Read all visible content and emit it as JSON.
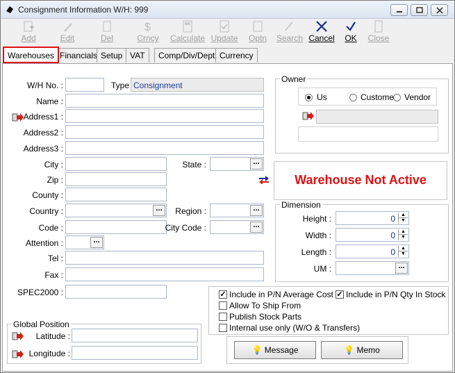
{
  "window": {
    "title": "Consignment Information   W/H: 999"
  },
  "toolbar": {
    "add": "Add",
    "edit": "Edit",
    "del": "Del",
    "crncy": "Crncy",
    "calculate": "Calculate",
    "update": "Update",
    "optn": "Optn",
    "search": "Search",
    "cancel": "Cancel",
    "ok": "OK",
    "close": "Close"
  },
  "tabs": [
    "Warehouses",
    "Financials",
    "Setup",
    "VAT",
    "Comp/Div/Dept",
    "Currency"
  ],
  "form": {
    "wh_no_label": "W/H No. :",
    "type_label": "Type",
    "type_value": "Consignment",
    "name_label": "Name :",
    "address1_label": "Address1 :",
    "address2_label": "Address2 :",
    "address3_label": "Address3 :",
    "city_label": "City :",
    "state_label": "State :",
    "zip_label": "Zip :",
    "county_label": "County :",
    "country_label": "Country :",
    "region_label": "Region :",
    "code_label": "Code :",
    "city_code_label": "City Code :",
    "attention_label": "Attention :",
    "tel_label": "Tel :",
    "fax_label": "Fax :",
    "spec2000_label": "SPEC2000 :"
  },
  "owner": {
    "title": "Owner",
    "us": "Us",
    "customer": "Customer",
    "vendor": "Vendor",
    "selected": "Us"
  },
  "status": {
    "text": "Warehouse Not Active",
    "color": "#e01010"
  },
  "dimension": {
    "title": "Dimension",
    "height_label": "Height :",
    "width_label": "Width :",
    "length_label": "Length :",
    "um_label": "UM :",
    "height": "0",
    "width": "0",
    "length": "0"
  },
  "options": {
    "avg_cost": "Include in P/N Average Cost",
    "avg_cost_checked": true,
    "qty_in_stock": "Include in P/N Qty In Stock",
    "qty_in_stock_checked": true,
    "allow_ship": "Allow To Ship From",
    "publish": "Publish Stock Parts",
    "internal": "Internal use only (W/O & Transfers)"
  },
  "global_position": {
    "title": "Global Position",
    "latitude_label": "Latitude :",
    "longitude_label": "Longitude :"
  },
  "buttons": {
    "message": "Message",
    "memo": "Memo"
  }
}
